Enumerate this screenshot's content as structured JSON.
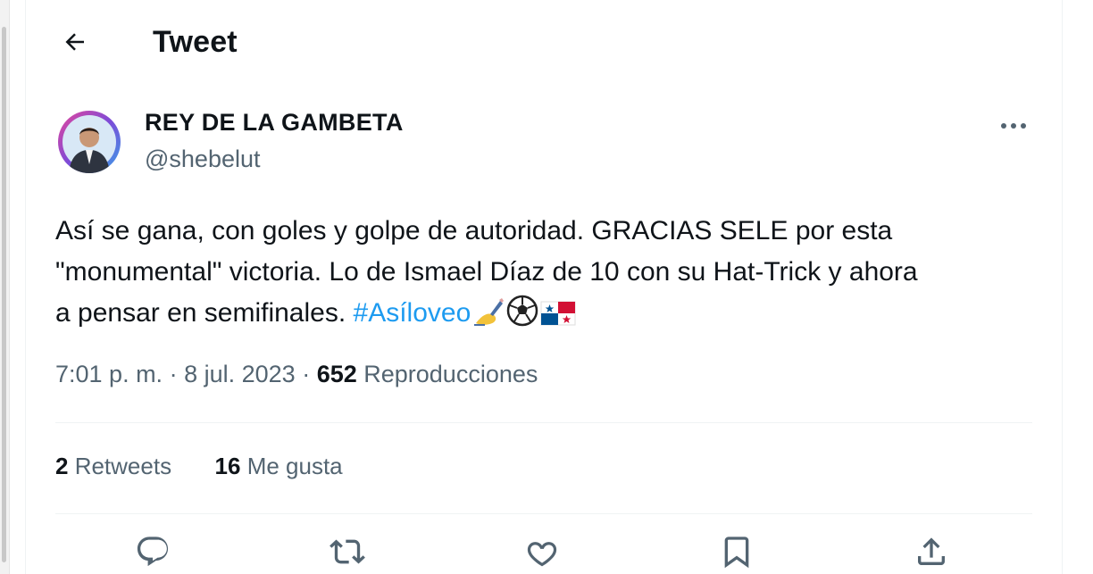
{
  "header": {
    "title": "Tweet"
  },
  "author": {
    "display_name": "REY DE LA GAMBETA",
    "handle": "@shebelut"
  },
  "tweet": {
    "text_1": "Así se gana, con goles y golpe de autoridad. GRACIAS SELE por esta",
    "text_2": "\"monumental\" victoria. Lo de Ismael Díaz de 10 con su Hat-Trick y ahora",
    "text_3": "a pensar en semifinales. ",
    "hashtag": "#Asíloveo",
    "emojis": [
      "writing-hand",
      "soccer-ball",
      "panama-flag"
    ]
  },
  "meta": {
    "time": "7:01 p. m.",
    "separator": " · ",
    "date": "8 jul. 2023",
    "views_count": "652",
    "views_label": " Reproducciones"
  },
  "stats": {
    "retweets_count": "2",
    "retweets_label": " Retweets",
    "likes_count": "16",
    "likes_label": " Me gusta"
  },
  "actions": [
    "reply-icon",
    "retweet-icon",
    "like-icon",
    "bookmark-icon",
    "share-icon"
  ],
  "colors": {
    "link": "#1d9bf0",
    "secondary_text": "#536471",
    "primary_text": "#0f1419",
    "divider": "#eff3f4"
  }
}
